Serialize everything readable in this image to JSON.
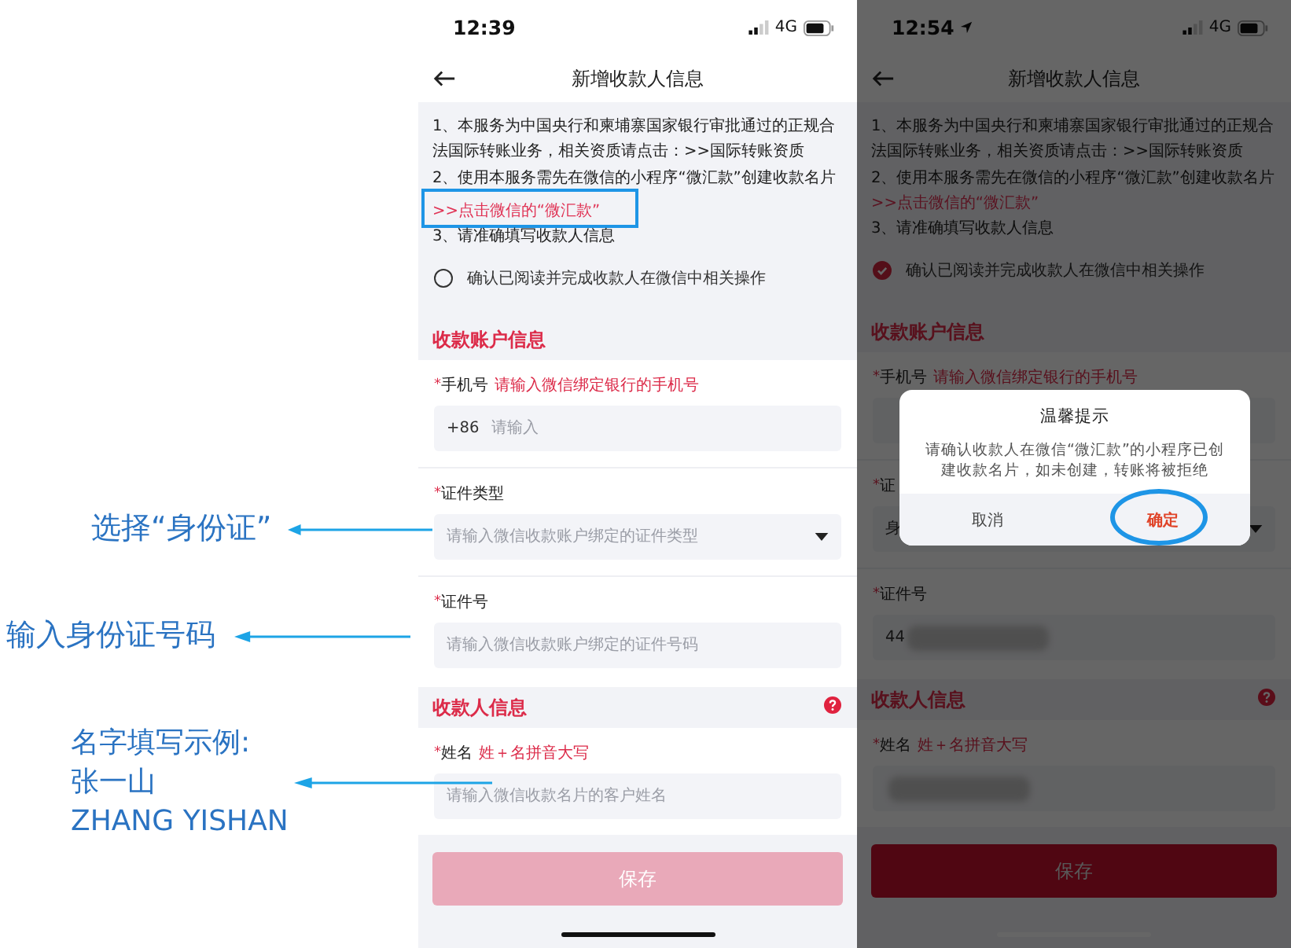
{
  "annotations": [
    {
      "lines": [
        "选择“身份证”"
      ]
    },
    {
      "lines": [
        "输入身份证号码"
      ]
    },
    {
      "lines": [
        "名字填写示例:",
        "张一山",
        "ZHANG YISHAN"
      ]
    }
  ],
  "phones": [
    {
      "status": {
        "time": "12:39",
        "location": false,
        "network": "4G"
      },
      "title": "新增收款人信息",
      "notice": [
        {
          "kind": "text",
          "text": "1、本服务为中国央行和柬埔寨国家银行审批通过的正规合法国际转账业务，相关资质请点击：>>国际转账资质"
        },
        {
          "kind": "text",
          "text": "2、使用本服务需先在微信的小程序“微汇款”创建收款名片"
        },
        {
          "kind": "link",
          "text": ">>点击微信的“微汇款”",
          "highlighted": true
        },
        {
          "kind": "text",
          "text": "3、请准确填写收款人信息"
        }
      ],
      "confirm": {
        "label": "确认已阅读并完成收款人在微信中相关操作",
        "checked": false
      },
      "sections": [
        {
          "title": "收款账户信息",
          "help": false,
          "fields": [
            {
              "kind": "text",
              "required_mark": "*",
              "label": "手机号",
              "hint": "请输入微信绑定银行的手机号",
              "prefix": "+86",
              "placeholder": "请输入"
            },
            {
              "kind": "select",
              "required_mark": "*",
              "label": "证件类型",
              "placeholder": "请输入微信收款账户绑定的证件类型"
            },
            {
              "kind": "text",
              "required_mark": "*",
              "label": "证件号",
              "placeholder": "请输入微信收款账户绑定的证件号码"
            }
          ]
        },
        {
          "title": "收款人信息",
          "help": true,
          "fields": [
            {
              "kind": "text",
              "required_mark": "*",
              "label": "姓名",
              "hint": "姓＋名拼音大写",
              "placeholder": "请输入微信收款名片的客户姓名"
            }
          ]
        }
      ],
      "save": {
        "label": "保存",
        "disabled": true
      }
    },
    {
      "status": {
        "time": "12:54",
        "location": true,
        "network": "4G"
      },
      "title": "新增收款人信息",
      "notice": [
        {
          "kind": "text",
          "text": "1、本服务为中国央行和柬埔寨国家银行审批通过的正规合法国际转账业务，相关资质请点击：>>国际转账资质"
        },
        {
          "kind": "text",
          "text": "2、使用本服务需先在微信的小程序“微汇款”创建收款名片"
        },
        {
          "kind": "link",
          "text": ">>点击微信的“微汇款”",
          "highlighted": false
        },
        {
          "kind": "text",
          "text": "3、请准确填写收款人信息"
        }
      ],
      "confirm": {
        "label": "确认已阅读并完成收款人在微信中相关操作",
        "checked": true
      },
      "sections": [
        {
          "title": "收款账户信息",
          "help": false,
          "fields": [
            {
              "kind": "text",
              "required_mark": "*",
              "label": "手机号",
              "hint": "请输入微信绑定银行的手机号"
            },
            {
              "kind": "select",
              "required_mark": "*",
              "label": "证",
              "value": "身"
            },
            {
              "kind": "text",
              "required_mark": "*",
              "label": "证件号",
              "value": "44",
              "blurred": true
            }
          ]
        },
        {
          "title": "收款人信息",
          "help": true,
          "fields": [
            {
              "kind": "text",
              "required_mark": "*",
              "label": "姓名",
              "hint": "姓＋名拼音大写",
              "blurred": true
            }
          ]
        }
      ],
      "save": {
        "label": "保存",
        "disabled": false
      },
      "dialog": {
        "title": "温馨提示",
        "message": "请确认收款人在微信“微汇款”的小程序已创建收款名片，如未创建，转账将被拒绝",
        "buttons": [
          {
            "label": "取消",
            "primary": false
          },
          {
            "label": "确定",
            "primary": true,
            "highlighted": true
          }
        ]
      }
    }
  ]
}
